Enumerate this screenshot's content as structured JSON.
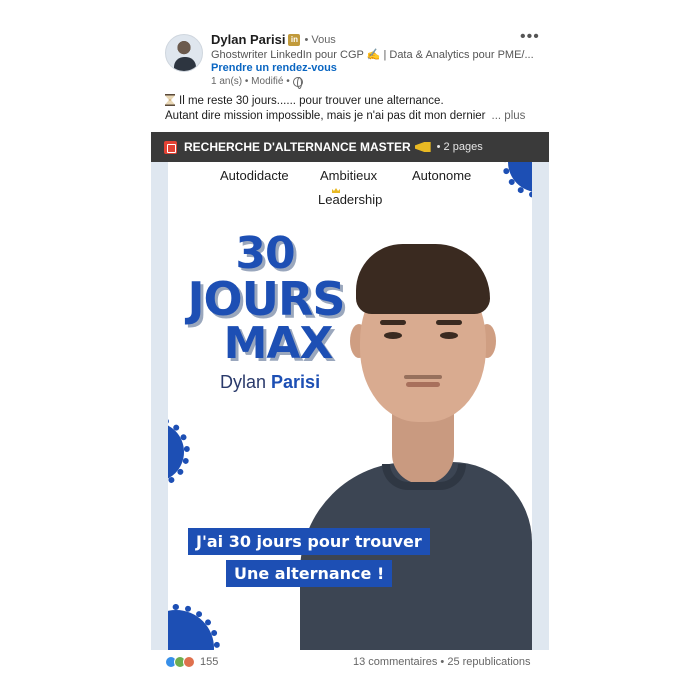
{
  "post": {
    "author": {
      "name": "Dylan Parisi",
      "badge": "in",
      "relation": "• Vous",
      "headline": "Ghostwriter LinkedIn pour CGP ✍️ | Data & Analytics pour PME/...",
      "cta": "Prendre un rendez-vous",
      "meta": "1 an(s) • Modifié •"
    },
    "menu_icon": "•••",
    "text": {
      "line1": "Il me reste 30 jours...... pour trouver une alternance.",
      "line2": "Autant dire mission impossible, mais je n'ai pas dit mon dernier",
      "see_more": "... plus"
    },
    "document": {
      "title": "RECHERCHE D'ALTERNANCE MASTER",
      "pages": "• 2 pages",
      "slide": {
        "traits": [
          "Autodidacte",
          "Ambitieux",
          "Autonome",
          "Leadership"
        ],
        "headline_30": "30",
        "headline_jours": "JOURS",
        "headline_max": "MAX",
        "first_name": "Dylan",
        "last_name": "Parisi",
        "caption_line1": "J'ai 30 jours pour trouver",
        "caption_line2": "Une alternance !"
      }
    },
    "footer": {
      "reaction_count": "155",
      "comments": "13 commentaires • 25 republications"
    },
    "colors": {
      "accent": "#1d4fb4",
      "link": "#0a66c2",
      "doc_bar": "#3a3a3a"
    },
    "icons": [
      "avatar",
      "linkedin-badge-icon",
      "globe-icon",
      "more-icon",
      "hourglass-icon",
      "document-icon",
      "horn-icon",
      "crown-icon",
      "like-icon",
      "celebrate-icon",
      "love-icon"
    ]
  }
}
